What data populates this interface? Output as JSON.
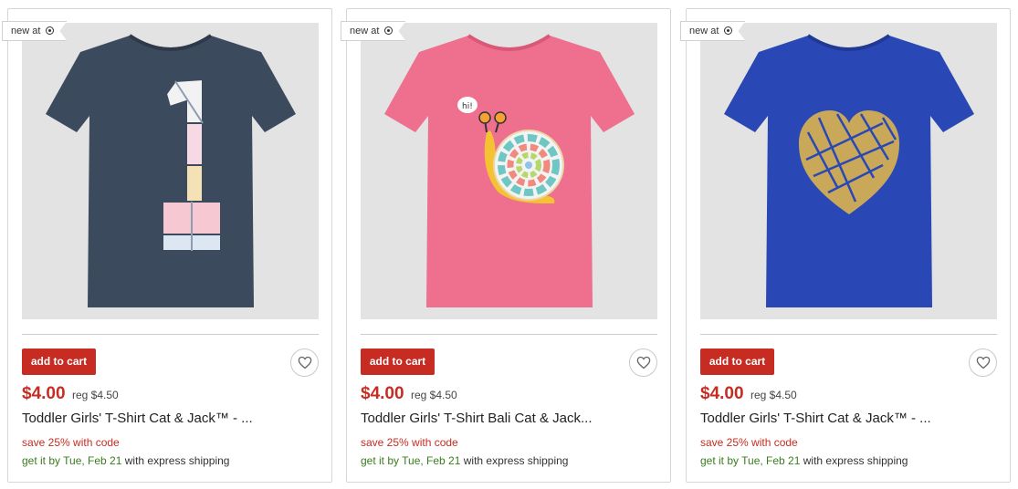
{
  "products": [
    {
      "badge": "new at",
      "shirt_color": "#3c4a5e",
      "design": "number-one",
      "button_label": "add to cart",
      "price": "$4.00",
      "reg_price": "reg $4.50",
      "title": "Toddler Girls' T-Shirt Cat & Jack™ - ...",
      "promo": "save 25% with code",
      "ship_prefix": "get it by Tue, Feb 21",
      "ship_suffix": "with express shipping"
    },
    {
      "badge": "new at",
      "shirt_color": "#ee6f8e",
      "design": "snail",
      "button_label": "add to cart",
      "price": "$4.00",
      "reg_price": "reg $4.50",
      "title": "Toddler Girls' T-Shirt Bali Cat & Jack...",
      "promo": "save 25% with code",
      "ship_prefix": "get it by Tue, Feb 21",
      "ship_suffix": "with express shipping"
    },
    {
      "badge": "new at",
      "shirt_color": "#2a48b5",
      "design": "gold-heart",
      "button_label": "add to cart",
      "price": "$4.00",
      "reg_price": "reg $4.50",
      "title": "Toddler Girls' T-Shirt Cat & Jack™ - ...",
      "promo": "save 25% with code",
      "ship_prefix": "get it by Tue, Feb 21",
      "ship_suffix": "with express shipping"
    }
  ],
  "colors": {
    "accent": "#c62c22",
    "delivery_green": "#3a7d1d"
  },
  "icons": {
    "badge": "target-logo-icon",
    "favorite": "heart-outline-icon"
  }
}
